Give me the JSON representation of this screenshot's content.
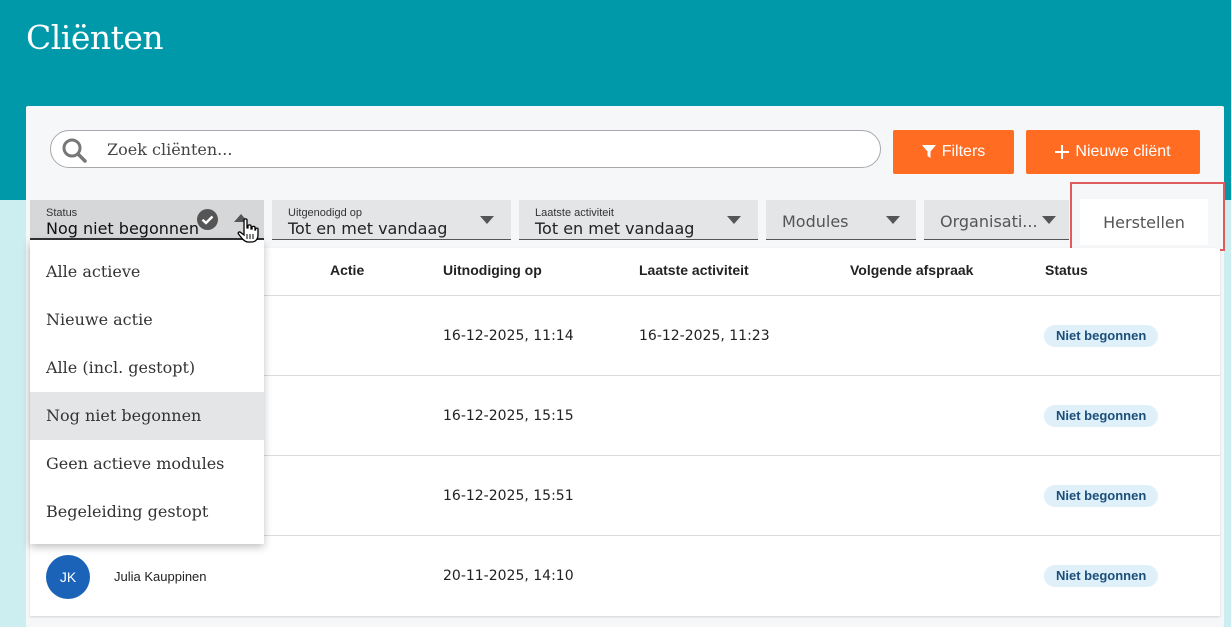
{
  "page": {
    "title": "Cliënten"
  },
  "search": {
    "placeholder": "Zoek cliënten..."
  },
  "toolbar": {
    "filters_label": "Filters",
    "new_client_label": "Nieuwe cliënt",
    "reset_label": "Herstellen"
  },
  "filters": {
    "status": {
      "label": "Status",
      "value": "Nog niet begonnen"
    },
    "invited": {
      "label": "Uitgenodigd op",
      "value": "Tot en met vandaag"
    },
    "activity": {
      "label": "Laatste activiteit",
      "value": "Tot en met vandaag"
    },
    "modules": {
      "value": "Modules"
    },
    "organisation": {
      "value": "Organisati..."
    }
  },
  "status_options": [
    "Alle actieve",
    "Nieuwe actie",
    "Alle (incl. gestopt)",
    "Nog niet begonnen",
    "Geen actieve modules",
    "Begeleiding gestopt"
  ],
  "status_selected": "Nog niet begonnen",
  "table": {
    "headers": [
      "Actie",
      "Uitnodiging op",
      "Laatste activiteit",
      "Volgende afspraak",
      "Status"
    ],
    "rows": [
      {
        "initials": "",
        "name": "",
        "invited": "16-12-2025, 11:14",
        "last_activity": "16-12-2025, 11:23",
        "status": "Niet begonnen"
      },
      {
        "initials": "",
        "name": "",
        "invited": "16-12-2025, 15:15",
        "last_activity": "",
        "status": "Niet begonnen"
      },
      {
        "initials": "",
        "name": "",
        "invited": "16-12-2025, 15:51",
        "last_activity": "",
        "status": "Niet begonnen"
      },
      {
        "initials": "JK",
        "name": "Julia Kauppinen",
        "invited": "20-11-2025, 14:10",
        "last_activity": "",
        "status": "Niet begonnen"
      }
    ]
  },
  "colors": {
    "header": "#0099aa",
    "accent": "#ff6c22",
    "avatar": "#1a63b8",
    "badge_bg": "#dff0fb"
  },
  "icons": {
    "search": "search-icon",
    "filter": "filter-icon",
    "plus": "plus-icon",
    "check": "check-circle-icon",
    "caret": "caret-icon",
    "cursor": "hand-pointer-icon"
  }
}
